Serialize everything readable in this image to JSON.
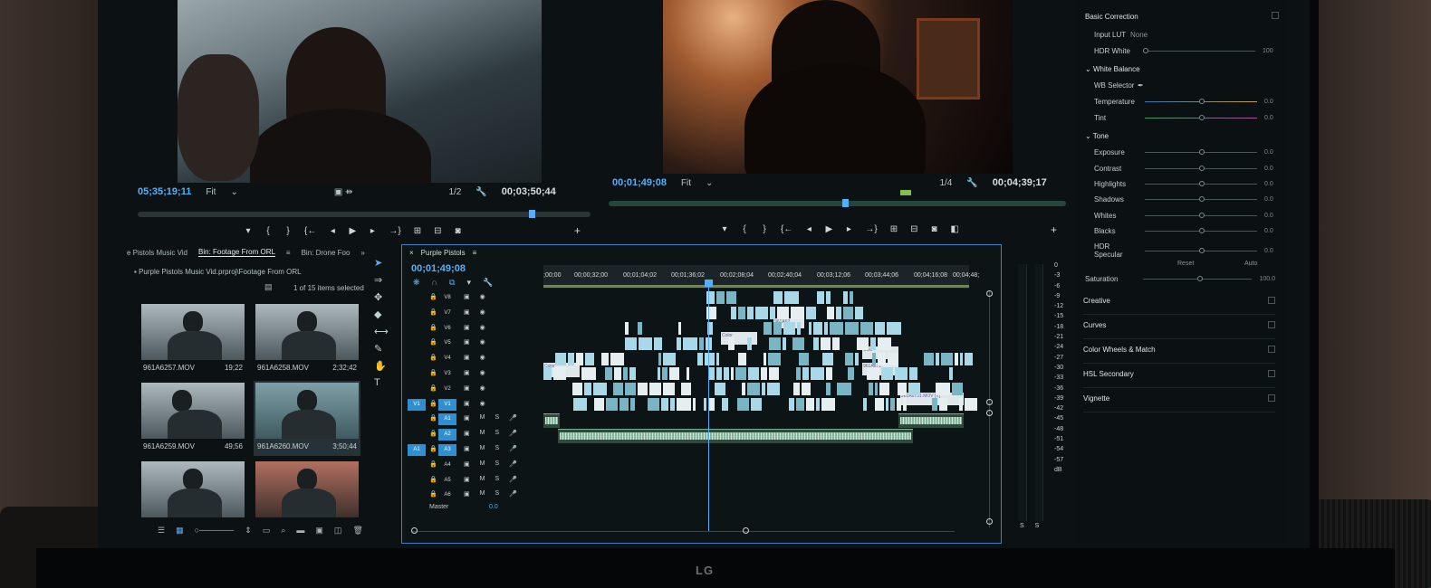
{
  "source_monitor": {
    "timecode_current": "05;35;19;11",
    "fit": "Fit",
    "resolution": "1/2",
    "timecode_duration": "00;03;50;44"
  },
  "program_monitor": {
    "timecode_current": "00;01;49;08",
    "fit": "Fit",
    "resolution": "1/4",
    "timecode_duration": "00;04;39;17"
  },
  "project_panel": {
    "tabs": [
      "e Pistols Music Vid",
      "Bin: Footage From ORL",
      "Bin: Drone Foo"
    ],
    "path": "Purple Pistols Music Vid.prproj\\Footage From ORL",
    "items_selected": "1 of 15 items selected",
    "clips": [
      {
        "name": "961A6257.MOV",
        "duration": "19;22"
      },
      {
        "name": "961A6258.MOV",
        "duration": "2;32;42"
      },
      {
        "name": "961A6259.MOV",
        "duration": "49;56"
      },
      {
        "name": "961A6260.MOV",
        "duration": "3;50;44"
      },
      {
        "name": "",
        "duration": ""
      },
      {
        "name": "",
        "duration": ""
      }
    ]
  },
  "timeline": {
    "sequence_name": "Purple Pistols",
    "timecode": "00;01;49;08",
    "ruler": [
      ";00;00",
      "00;00;32;00",
      "00;01;04;02",
      "00;01;36;02",
      "00;02;08;04",
      "00;02;40;04",
      "00;03;12;06",
      "00;03;44;06",
      "00;04;16;08",
      "00;04;48;"
    ],
    "video_tracks": [
      "V8",
      "V7",
      "V6",
      "V5",
      "V4",
      "V3",
      "V2",
      "V1"
    ],
    "audio_tracks": [
      "A1",
      "A2",
      "A3",
      "A4",
      "A5",
      "A6"
    ],
    "source_v": "V1",
    "source_a": "A1",
    "master_label": "Master",
    "master_value": "0.0",
    "clip_labels": {
      "c1": "961A62",
      "c2": "Color",
      "c3": "Colo",
      "c4": "Color",
      "c5": "961A671",
      "c6": "961A6731.MOV [V]"
    }
  },
  "meter": {
    "scale": [
      "0",
      "-3",
      "-6",
      "-9",
      "-12",
      "-15",
      "-18",
      "-21",
      "-24",
      "-27",
      "-30",
      "-33",
      "-36",
      "-39",
      "-42",
      "-45",
      "-48",
      "-51",
      "-54",
      "-57",
      "dB"
    ],
    "solo_labels": [
      "S",
      "S"
    ]
  },
  "lumetri": {
    "basic_correction": "Basic Correction",
    "input_lut_label": "Input LUT",
    "input_lut_value": "None",
    "hdr_white_label": "HDR White",
    "hdr_white_value": "100",
    "white_balance": "White Balance",
    "wb_selector": "WB Selector",
    "temperature": "Temperature",
    "tint": "Tint",
    "tone": "Tone",
    "exposure": "Exposure",
    "contrast": "Contrast",
    "highlights": "Highlights",
    "shadows": "Shadows",
    "whites": "Whites",
    "blacks": "Blacks",
    "hdr_specular": "HDR Specular",
    "zero": "0.0",
    "reset": "Reset",
    "auto": "Auto",
    "saturation": "Saturation",
    "saturation_value": "100.0",
    "sections": [
      "Creative",
      "Curves",
      "Color Wheels & Match",
      "HSL Secondary",
      "Vignette"
    ]
  },
  "brand": "LG"
}
